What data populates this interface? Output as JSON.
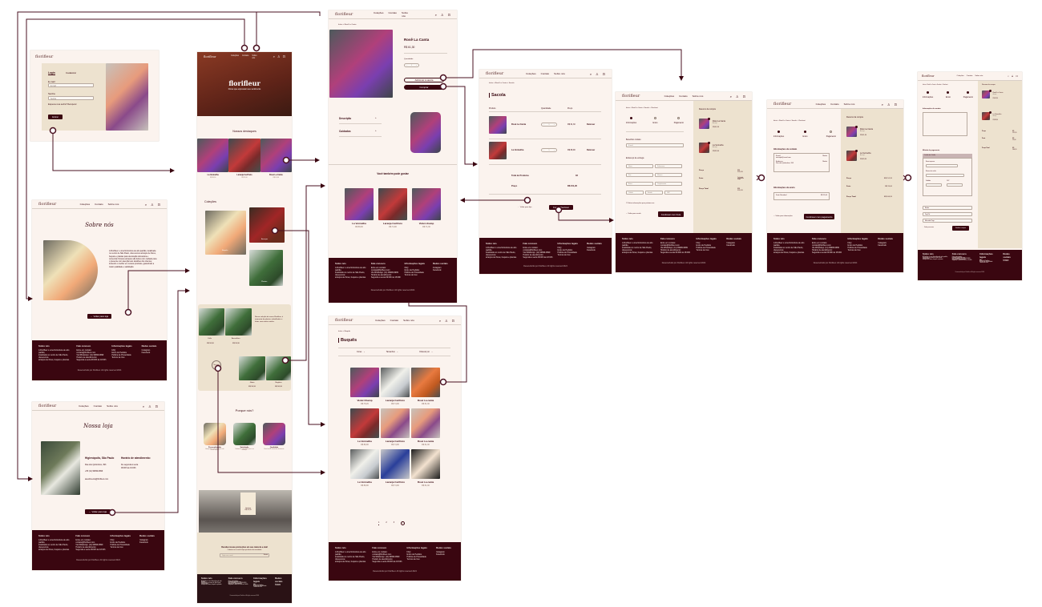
{
  "brand": "florifleur",
  "nav": [
    "Coleções",
    "Contato",
    "Sobre nós"
  ],
  "footer": {
    "cols": [
      {
        "title": "Sobre nós",
        "lines": [
          "A Florifleur é uma floricultura de alto padrão,",
          "localizada no centro de São Paulo, oferecemos",
          "arranjos de flores, buquês e plantas."
        ]
      },
      {
        "title": "Fale conosco",
        "lines": [
          "Entre em contato:",
          "contato@florifleur.com",
          "Via WhatsApp: (11) 99999-9999",
          "Horário de atendimento:",
          "Segunda a sexta 09:00h às 18:00h"
        ]
      },
      {
        "title": "Informações legais",
        "lines": [
          "FAQ",
          "Envio de Pedidos",
          "Política de Privacidade",
          "Termos de Uso"
        ]
      },
      {
        "title": "Redes sociais",
        "lines": [
          "Instagram",
          "Facebook"
        ]
      }
    ],
    "copyright": "Desenvolvido por Florifleur. All rights reserved 2024"
  },
  "login": {
    "tab_login": "Login",
    "tab_register": "Cadastrar",
    "email_label": "E-mail",
    "email_placeholder": "E-mail",
    "password_label": "Senha",
    "password_placeholder": "Senha",
    "forgot": "Esqueceu sua senha? Recuperar",
    "submit": "Entrar"
  },
  "about": {
    "title": "Sobre nós",
    "text": "A Florifleur é uma floricultura de alto padrão, localizada no centro de São Paulo, oferecemos arranjos de flores, buquês e plantas para decoração doméstica e comercial. Nossos arranjos são feitos com cuidado para o presente com atenção aos detalhes dos clientes, trazendo o melhor em nossos produtos, garantindo a maior qualidade e satisfação.",
    "back": "← Voltar para loja"
  },
  "store": {
    "title": "Nossa loja",
    "city": "Higienópolis, São Paulo",
    "address": "Rua dos Quilombos, 393",
    "phone": "+55 (11) 99999-9999",
    "email": "atendimento@florifleur.com",
    "hours_title": "Horário de atendimento:",
    "hours_1": "De segunda à sexta",
    "hours_2": "09:00h às 19:00h",
    "back": "← Voltar para loja"
  },
  "home": {
    "hero_title": "florifleur",
    "hero_sub": "Flores que expressam seu sentimento",
    "highlights_title": "Nossos destaques",
    "highlights": [
      {
        "name": "La Vermelha",
        "price": "R$ 89,90"
      },
      {
        "name": "Laranja Cerifruto",
        "price": "R$ 74,90"
      },
      {
        "name": "Rosê La Canta",
        "price": "R$ 61,30"
      }
    ],
    "collections_title": "Coleções",
    "collections": [
      "Buquês",
      "Arranjos",
      "Plantas"
    ],
    "plants_text": "Nossa coleção de vasos Florifleur, é momento de plantas, trabalhadas e feitas com muito carinho.",
    "plants": [
      {
        "name": "Calla",
        "price": "R$ 58,90"
      },
      {
        "name": "Anasoflora",
        "price": "R$ 58,90"
      },
      {
        "name": "Jiboia",
        "price": "R$ 58,90"
      },
      {
        "name": "Begônia",
        "price": "R$ 58,90"
      }
    ],
    "see_more": "Ver mais",
    "why_title": "Porque nós?",
    "why": [
      {
        "title": "Personalização",
        "text": "Arranjos feitos sob medida para cada ocasião especial."
      },
      {
        "title": "Satisfação",
        "text": "Cuidamos de cada detalhe para a sua satisfação."
      },
      {
        "title": "Qualidade",
        "text": "Flores frescas selecionadas diariamente."
      }
    ],
    "promo_name": "Gerânio",
    "promo_price": "R$ 49,90",
    "newsletter_title": "Receba nossas promoções em seu caixa de e-mail",
    "newsletter_sub": "Cadastre seu e-mail e fique por dentro das novidades",
    "newsletter_placeholder": "Digite seu e-mail",
    "newsletter_button": "Enviar"
  },
  "product": {
    "breadcrumb": "Início > Rosê La Canta",
    "name": "Rosê La Canta",
    "price": "R$ 61,30",
    "qty_label": "Quantidade",
    "qty": "1",
    "add_to_cart": "Adicionar à sacola",
    "buy": "Comprar",
    "accordion": [
      "Descrição",
      "Cuidados"
    ],
    "related_title": "Você também pode gostar",
    "related": [
      {
        "name": "La Vermelha",
        "price": "R$ 89,90"
      },
      {
        "name": "Laranja Cerifruto",
        "price": "R$ 74,90"
      },
      {
        "name": "Violet champ",
        "price": "R$ 71,30"
      }
    ]
  },
  "catalog": {
    "breadcrumb": "Início > Buquês",
    "title": "Buquês",
    "filters": [
      "Cores",
      "Tamanhos",
      "Ordenar por"
    ],
    "items": [
      {
        "name": "Violet Champ",
        "price": "R$ 78,20"
      },
      {
        "name": "Laranja Cerifruto",
        "price": "R$ 74,90"
      },
      {
        "name": "Rosê La canta",
        "price": "R$ 61,30"
      },
      {
        "name": "La Vermelha",
        "price": "R$ 89,90"
      },
      {
        "name": "Laranja Cerifruto",
        "price": "R$ 74,90"
      },
      {
        "name": "Rosê La canta",
        "price": "R$ 61,30"
      },
      {
        "name": "La Vermelha",
        "price": "R$ 89,90"
      },
      {
        "name": "Laranja Cerifruto",
        "price": "R$ 74,90"
      },
      {
        "name": "Rosê La canta",
        "price": "R$ 61,30"
      }
    ],
    "pages": [
      "1",
      "2",
      "3"
    ]
  },
  "cart": {
    "breadcrumb": "Início > Rosê La Canta > Sacola",
    "title": "Sacola",
    "headers": [
      "Produto",
      "Quantidade",
      "Preço"
    ],
    "items": [
      {
        "name": "Rosê La Canta",
        "qty": "1",
        "price": "R$ 61,30",
        "remove": "Remover"
      },
      {
        "name": "La Vermelha",
        "qty": "1",
        "price": "R$ 89,90",
        "remove": "Remover"
      }
    ],
    "total_label": "Total de Produtos",
    "total_count": "02",
    "price_label": "Preço",
    "price": "R$ 151,20",
    "back": "← Voltar para loja",
    "checkout": "Fazer Checkout"
  },
  "checkout": {
    "breadcrumb": "Início > Rosê La Canta > Sacola > Checkout",
    "steps": [
      "Informações",
      "Envio",
      "Pagamento"
    ],
    "summary_title": "Resumo da compra",
    "summary_items": [
      {
        "name": "Rosê La Canta",
        "sub": "Arranjo",
        "price": "R$ 61,30"
      },
      {
        "name": "La Vermelha",
        "sub": "Arranjo",
        "price": "R$ 89,90"
      }
    ],
    "price_label": "Preço",
    "price": "R$ 151,20",
    "shipping_label": "Frete",
    "shipping_value": "Calculado na próxima etapa",
    "total_label": "Preço Total",
    "total": "R$ 151,20",
    "contact_title": "Benefício contato",
    "email_placeholder": "E-mail",
    "address_title": "Endereço de entrega",
    "address_fields": [
      "Nome",
      "Sobrenome",
      "Rua",
      "Número",
      "Bairro",
      "Complemento",
      "Cidade",
      "Estado",
      "CEP"
    ],
    "save_info": "Salvar informações para próxima vez",
    "back": "← Voltar para sacola",
    "continue": "Continuar com frete",
    "contact_info_title": "Informações de contato",
    "contact_info": [
      {
        "label": "E-mail",
        "value": "exemplo@email.com",
        "action": "Mudar"
      },
      {
        "label": "Endereço",
        "value": "Rua dos Quilombos, 393",
        "action": "Mudar"
      }
    ],
    "shipping_title": "Informações de envio",
    "shipping_option": "Frete Standard",
    "shipping_price": "R$ 15,00",
    "back2": "← Voltar para informações",
    "continue2": "Continuar com pagamento",
    "payment_title": "Método de pagamento",
    "payment_methods": [
      "Cartão de Crédito",
      "Boleto",
      "Pay Pal",
      "Mercado Pago"
    ],
    "card_fields": [
      "Nome impresso",
      "Número do cartão",
      "Validade",
      "CVV"
    ],
    "back3": "← Voltar para envio",
    "finish": "Finalizar compra",
    "shipping_value2": "R$ 15,00",
    "total2": "R$ 166,20"
  },
  "colors": {
    "maroon": "#3a0610",
    "cream": "#fbf3ee",
    "beige": "#ede2cf",
    "connector": "#4a1020"
  }
}
